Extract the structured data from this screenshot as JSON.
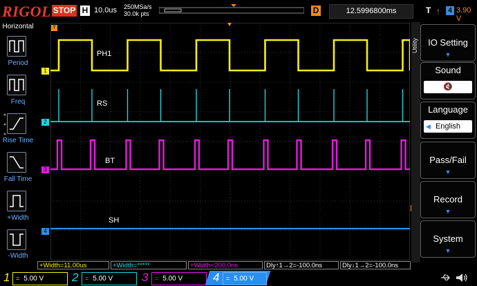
{
  "header": {
    "brand": "RIGOL",
    "run_state": "STOP",
    "horizontal_badge": "H",
    "timebase": "10.0us",
    "sample_rate": "250MSa/s",
    "memory_depth": "30.0k pts",
    "delay_badge": "D",
    "delay_value": "12.5996800ms",
    "trigger_badge": "T",
    "trigger_channel": "4",
    "trigger_level": "3.90 V"
  },
  "left_menu": {
    "title": "Horizontal",
    "items": [
      {
        "label": "Period"
      },
      {
        "label": "Freq"
      },
      {
        "label": "Rise Time"
      },
      {
        "label": "Fall Time"
      },
      {
        "label": "+Width"
      },
      {
        "label": "-Width"
      }
    ]
  },
  "traces": [
    {
      "marker": "1",
      "label": "PH1",
      "color": "#f7ee1a"
    },
    {
      "marker": "2",
      "label": "RS",
      "color": "#1ad6e0"
    },
    {
      "marker": "3",
      "label": "BT",
      "color": "#e51ae0"
    },
    {
      "marker": "4",
      "label": "SH",
      "color": "#2a8ef0"
    }
  ],
  "right_menu": {
    "utility_tab": "Utility",
    "items": [
      {
        "title": "IO Setting"
      },
      {
        "title": "Sound"
      },
      {
        "title": "Language",
        "value": "English"
      },
      {
        "title": "Pass/Fail"
      },
      {
        "title": "Record"
      },
      {
        "title": "System"
      }
    ]
  },
  "measurements": [
    {
      "text": "+Width=11.00us",
      "color": "#f7ee1a"
    },
    {
      "text": "+Width=*****",
      "color": "#1ad6e0"
    },
    {
      "text": "+Width<200.0ns",
      "color": "#e51ae0"
    },
    {
      "text": "Dly↑1→2=-100.0ns",
      "color": "#ffffff"
    },
    {
      "text": "Dly↓1→2=-100.0ns",
      "color": "#ffffff"
    }
  ],
  "channels": [
    {
      "num": "1",
      "scale": "5.00 V",
      "color": "#f7ee1a"
    },
    {
      "num": "2",
      "scale": "5.00 V",
      "color": "#1ad6e0"
    },
    {
      "num": "3",
      "scale": "5.00 V",
      "color": "#e51ae0"
    },
    {
      "num": "4",
      "scale": "5.00 V",
      "color": "#2a8ef0"
    }
  ],
  "colors": {
    "brand": "#e23a2e",
    "accent": "#f18c1e",
    "menu_arrow": "#2f8cf0"
  },
  "icons": [
    "usb-icon",
    "speaker-icon",
    "sound-mute-icon"
  ]
}
